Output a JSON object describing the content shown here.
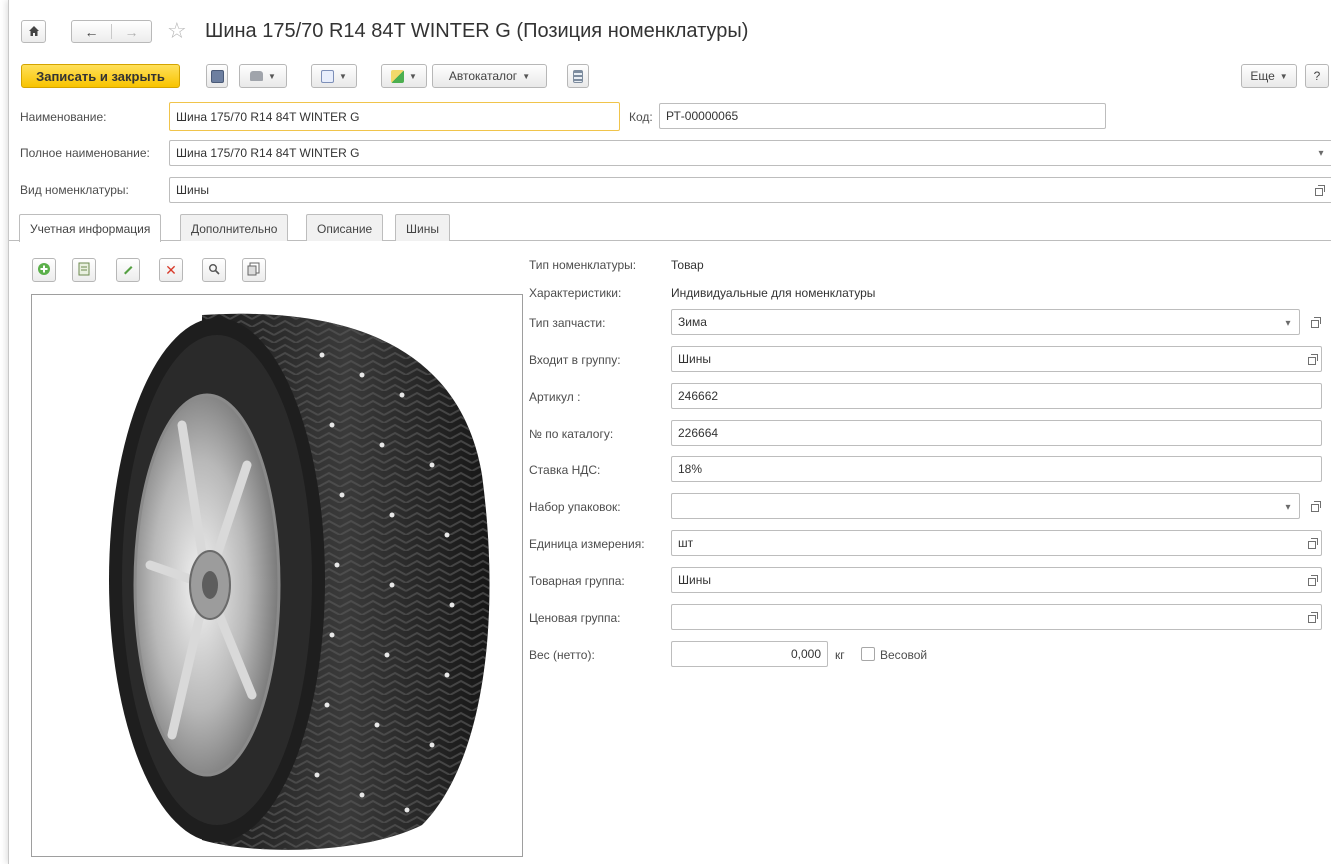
{
  "window": {
    "title": "Шина 175/70 R14 84T WINTER G (Позиция номенклатуры)",
    "nav": {
      "home_icon": "home-icon",
      "back_icon": "arrow-left-icon",
      "forward_icon": "arrow-right-icon",
      "favorite_icon": "star-icon"
    }
  },
  "toolbar": {
    "save_close_label": "Записать и закрыть",
    "autocatalog_label": "Автокаталог",
    "more_label": "Еще",
    "help_label": "?"
  },
  "header": {
    "name_label": "Наименование:",
    "name_value": "Шина 175/70 R14 84T WINTER G",
    "code_label": "Код:",
    "code_value": "РТ-00000065",
    "fullname_label": "Полное наименование:",
    "fullname_value": "Шина 175/70 R14 84T WINTER G",
    "kind_label": "Вид номенклатуры:",
    "kind_value": "Шины"
  },
  "tabs": [
    "Учетная информация",
    "Дополнительно",
    "Описание",
    "Шины"
  ],
  "details": {
    "type_label": "Тип номенклатуры:",
    "type_value": "Товар",
    "chars_label": "Характеристики:",
    "chars_value": "Индивидуальные для номенклатуры",
    "part_type_label": "Тип запчасти:",
    "part_type_value": "Зима",
    "group_label": "Входит в группу:",
    "group_value": "Шины",
    "article_label": "Артикул :",
    "article_value": "246662",
    "catalog_label": "№ по каталогу:",
    "catalog_value": "226664",
    "vat_label": "Ставка НДС:",
    "vat_value": "18%",
    "pack_label": "Набор упаковок:",
    "pack_value": "",
    "unit_label": "Единица измерения:",
    "unit_value": "шт",
    "product_group_label": "Товарная группа:",
    "product_group_value": "Шины",
    "price_group_label": "Ценовая группа:",
    "price_group_value": "",
    "weight_label": "Вес (нетто):",
    "weight_value": "0,000",
    "weight_unit": "кг",
    "weighted_label": "Весовой"
  },
  "colors": {
    "accent": "#f8c300",
    "focus": "#f0c44b",
    "border": "#bdbdbd"
  }
}
